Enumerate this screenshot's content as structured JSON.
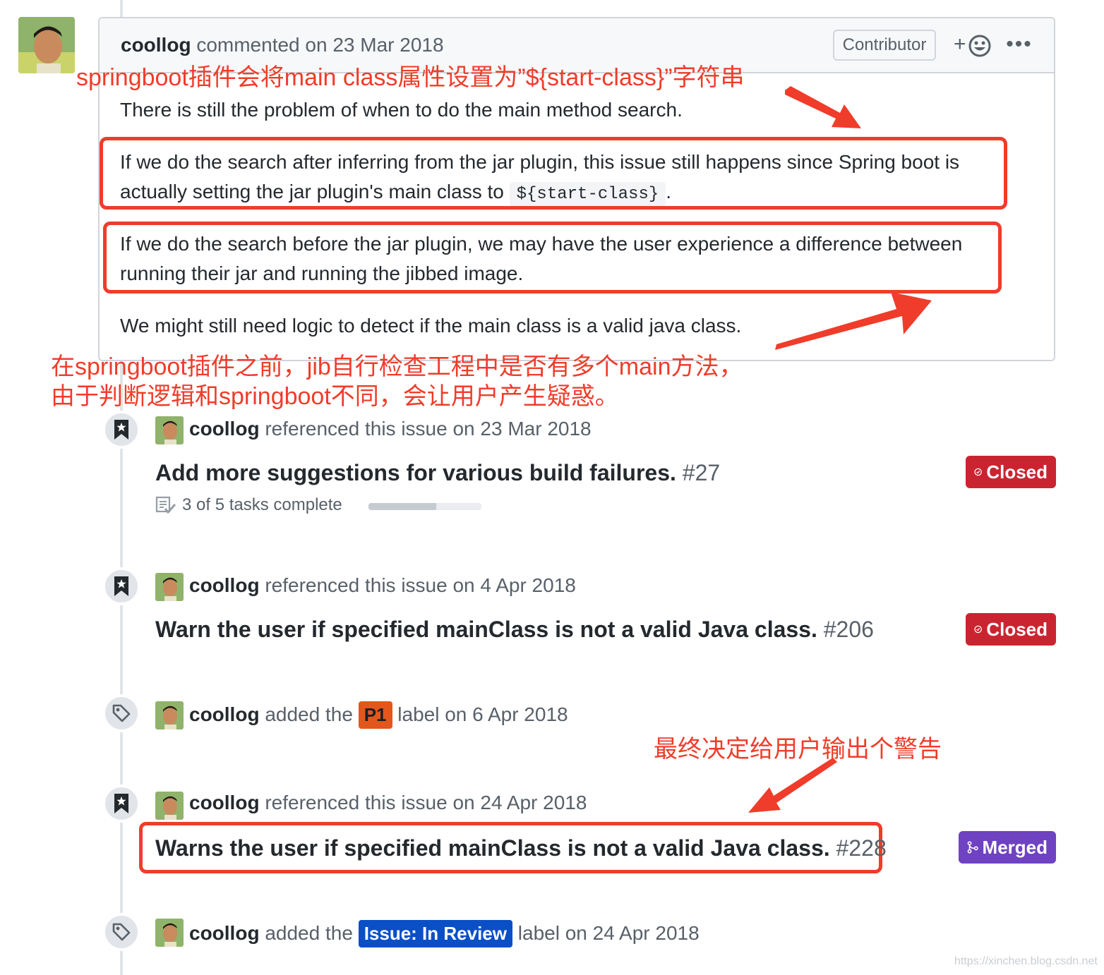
{
  "comment": {
    "author": "coollog",
    "action": "commented on 23 Mar 2018",
    "badge": "Contributor",
    "react_label": "+",
    "more_label": "•••",
    "p1": "There is still the problem of when to do the main method search.",
    "p2a": "If we do the search after inferring from the jar plugin, this issue still happens since Spring boot is",
    "p2b_pre": "actually setting the jar plugin's main class to ",
    "p2b_code": "${start-class}",
    "p2b_post": ".",
    "p3a": "If we do the search before the jar plugin, we may have the user experience a difference between",
    "p3b": "running their jar and running the jibbed image.",
    "p4": "We might still need logic to detect if the main class is a valid java class."
  },
  "annotations": {
    "top": "springboot插件会将main class属性设置为”${start-class}”字符串",
    "middle1": "在springboot插件之前，jib自行检查工程中是否有多个main方法，",
    "middle2": "由于判断逻辑和springboot不同，会让用户产生疑惑。",
    "bottom": "最终决定给用户输出个警告"
  },
  "events": [
    {
      "author": "coollog",
      "text": "referenced this issue on 23 Mar 2018",
      "title": "Add more suggestions for various build failures.",
      "number": "#27",
      "state": "Closed",
      "tasks": "3 of 5 tasks complete",
      "progress": 0.6
    },
    {
      "author": "coollog",
      "text": "referenced this issue on 4 Apr 2018",
      "title": "Warn the user if specified mainClass is not a valid Java class.",
      "number": "#206",
      "state": "Closed"
    },
    {
      "author": "coollog",
      "pre": "added the",
      "label": "P1",
      "post": "label on 6 Apr 2018"
    },
    {
      "author": "coollog",
      "text": "referenced this issue on 24 Apr 2018",
      "title": "Warns the user if specified mainClass is not a valid Java class.",
      "number": "#228",
      "state": "Merged"
    },
    {
      "author": "coollog",
      "pre": "added the",
      "label": "Issue: In Review",
      "post": "label on 24 Apr 2018"
    }
  ],
  "colors": {
    "closed": "#cb2431",
    "merged": "#6f42c1",
    "label_p1": "#e4571c",
    "label_review": "#0b4fc7",
    "annotation": "#f03c2a"
  },
  "icons": [
    "bookmark-icon",
    "tag-icon",
    "issue-closed-icon",
    "merge-icon",
    "smiley-icon",
    "tasklist-icon"
  ],
  "watermark": "https://xinchen.blog.csdn.net"
}
